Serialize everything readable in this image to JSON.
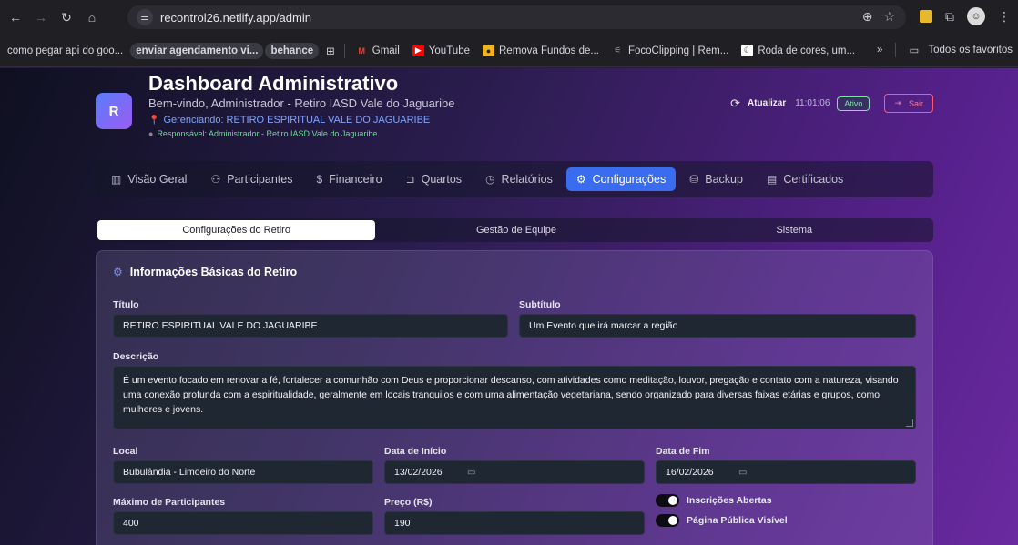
{
  "browser": {
    "url": "recontrol26.netlify.app/admin",
    "bookmarks": [
      {
        "label": "como pegar api do goo...",
        "pill": false
      },
      {
        "label": "enviar agendamento vi...",
        "pill": true
      },
      {
        "label": "behance",
        "pill": true
      },
      {
        "label": "Gmail",
        "pill": false
      },
      {
        "label": "YouTube",
        "pill": false
      },
      {
        "label": "Remova Fundos de...",
        "pill": false
      },
      {
        "label": "FocoClipping | Rem...",
        "pill": false
      },
      {
        "label": "Roda de cores, um...",
        "pill": false
      }
    ],
    "more_label": "»",
    "all_bookmarks_label": "Todos os favoritos"
  },
  "header": {
    "logo_letter": "R",
    "title": "Dashboard Administrativo",
    "subtitle": "Bem-vindo, Administrador - Retiro IASD Vale do Jaguaribe",
    "managing": "Gerenciando: RETIRO ESPIRITUAL VALE DO JAGUARIBE",
    "responsible": "Responsável: Administrador - Retiro IASD Vale do Jaguaribe",
    "refresh_label": "Atualizar",
    "time": "11:01:06",
    "status_badge": "Ativo",
    "logout_label": "Sair"
  },
  "nav": {
    "items": [
      {
        "label": "Visão Geral",
        "icon": "▥"
      },
      {
        "label": "Participantes",
        "icon": "⚇"
      },
      {
        "label": "Financeiro",
        "icon": "$"
      },
      {
        "label": "Quartos",
        "icon": "⊐"
      },
      {
        "label": "Relatórios",
        "icon": "◷"
      },
      {
        "label": "Configurações",
        "icon": "⚙"
      },
      {
        "label": "Backup",
        "icon": "⛁"
      },
      {
        "label": "Certificados",
        "icon": "▤"
      }
    ],
    "active_index": 5
  },
  "subtabs": {
    "items": [
      "Configurações do Retiro",
      "Gestão de Equipe",
      "Sistema"
    ],
    "active_index": 0
  },
  "card": {
    "title": "Informações Básicas do Retiro",
    "fields": {
      "titulo": {
        "label": "Título",
        "value": "RETIRO ESPIRITUAL VALE DO JAGUARIBE"
      },
      "subtitulo": {
        "label": "Subtítulo",
        "value": "Um Evento que irá marcar a região"
      },
      "descricao": {
        "label": "Descrição",
        "value": "É um evento focado em renovar a fé, fortalecer a comunhão com Deus e proporcionar descanso, com atividades como meditação, louvor, pregação e contato com a natureza, visando uma conexão profunda com a espiritualidade, geralmente em locais tranquilos e com uma alimentação vegetariana, sendo organizado para diversas faixas etárias e grupos, como mulheres e jovens."
      },
      "local": {
        "label": "Local",
        "value": "Bubulândia - Limoeiro do Norte"
      },
      "data_inicio": {
        "label": "Data de Início",
        "value": "13/02/2026"
      },
      "data_fim": {
        "label": "Data de Fim",
        "value": "16/02/2026"
      },
      "max_participantes": {
        "label": "Máximo de Participantes",
        "value": "400"
      },
      "preco": {
        "label": "Preço (R$)",
        "value": "190"
      }
    },
    "toggles": {
      "inscricoes": {
        "label": "Inscrições Abertas",
        "on": true
      },
      "pagina_publica": {
        "label": "Página Pública Visível",
        "on": true
      }
    }
  },
  "colors": {
    "accent": "#3a6cf0",
    "status_active": "#7ee2a3",
    "logout": "#ff5a6e"
  }
}
